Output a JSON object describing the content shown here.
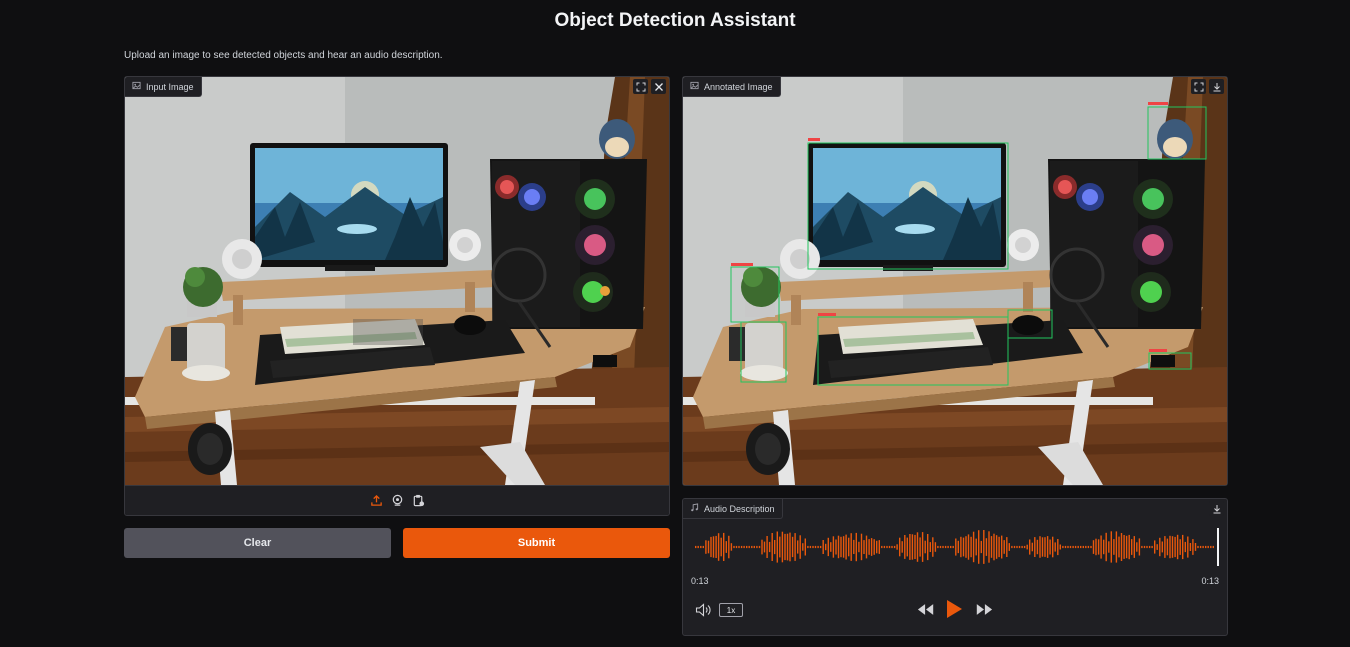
{
  "header": {
    "title": "Object Detection Assistant",
    "subtitle": "Upload an image to see detected objects and hear an audio description."
  },
  "input_panel": {
    "label": "Input Image",
    "icons": [
      "image-icon",
      "fullscreen-icon",
      "close-icon",
      "upload-icon",
      "webcam-icon",
      "clipboard-icon"
    ]
  },
  "output_panel": {
    "label": "Annotated Image",
    "icons": [
      "image-icon",
      "fullscreen-icon",
      "download-icon"
    ]
  },
  "buttons": {
    "clear_label": "Clear",
    "submit_label": "Submit"
  },
  "audio_panel": {
    "label": "Audio Description",
    "current_time": "0:13",
    "total_time": "0:13",
    "playback_speed": "1x",
    "progress": 1.0,
    "icons": [
      "music-icon",
      "download-icon",
      "volume-icon",
      "rewind-icon",
      "play-icon",
      "fast-forward-icon"
    ]
  },
  "colors": {
    "accent": "#ea580c",
    "background": "#0f0f11",
    "panel": "#1f1f23",
    "detection_box": "#22c55e",
    "detection_label": "#ef4444"
  }
}
